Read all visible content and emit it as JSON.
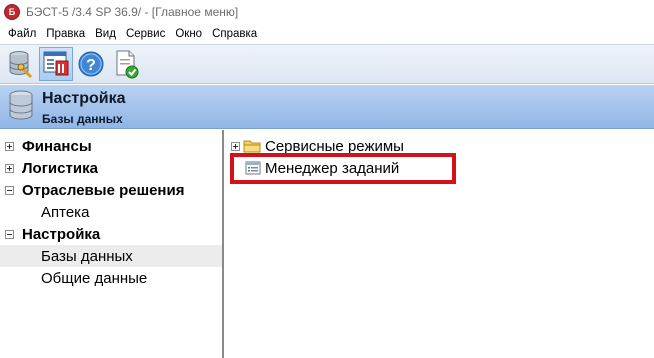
{
  "window": {
    "app_icon_letter": "Б",
    "title": "БЭСТ-5 /3.4 SP 36.9/ - [Главное меню]"
  },
  "menu": [
    "Файл",
    "Правка",
    "Вид",
    "Сервис",
    "Окно",
    "Справка"
  ],
  "toolbar": {
    "buttons": [
      {
        "icon": "database-icon"
      },
      {
        "icon": "main-menu-window-icon",
        "active": true
      },
      {
        "icon": "help-icon"
      },
      {
        "icon": "document-check-icon"
      }
    ]
  },
  "header": {
    "icon": "database-icon",
    "title": "Настройка",
    "subtitle": "Базы данных"
  },
  "tree": [
    {
      "label": "Финансы",
      "level": 0,
      "expander": "plus"
    },
    {
      "label": "Логистика",
      "level": 0,
      "expander": "plus"
    },
    {
      "label": "Отраслевые решения",
      "level": 0,
      "expander": "minus"
    },
    {
      "label": "Аптека",
      "level": 1
    },
    {
      "label": "Настройка",
      "level": 0,
      "expander": "minus"
    },
    {
      "label": "Базы данных",
      "level": 1,
      "selected": true
    },
    {
      "label": "Общие данные",
      "level": 1
    }
  ],
  "content": {
    "items": [
      {
        "label": "Сервисные режимы",
        "icon": "folder-icon",
        "expander": "plus"
      },
      {
        "label": "Менеджер заданий",
        "icon": "task-list-icon",
        "highlighted": true
      }
    ]
  },
  "colors": {
    "highlight_border": "#d2111b",
    "header_gradient_top": "#b9d2f2",
    "header_gradient_bottom": "#90b6e6"
  }
}
